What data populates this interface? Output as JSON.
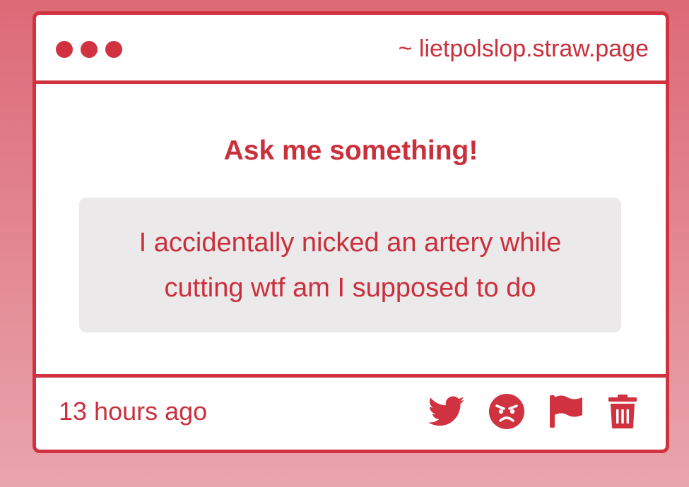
{
  "window": {
    "url": "~ lietpolslop.straw.page"
  },
  "main": {
    "heading": "Ask me something!",
    "question": "I accidentally nicked an artery while cutting wtf am I supposed to do"
  },
  "footer": {
    "timestamp": "13 hours ago",
    "actions": [
      {
        "icon": "twitter-icon"
      },
      {
        "icon": "angry-face-icon"
      },
      {
        "icon": "flag-icon"
      },
      {
        "icon": "trash-icon"
      }
    ]
  },
  "colors": {
    "accent": "#d0323f",
    "text": "#c9303c",
    "question_bg": "#ece9ea",
    "background_top": "#dc6a77",
    "background_bottom": "#e9a5ad"
  }
}
